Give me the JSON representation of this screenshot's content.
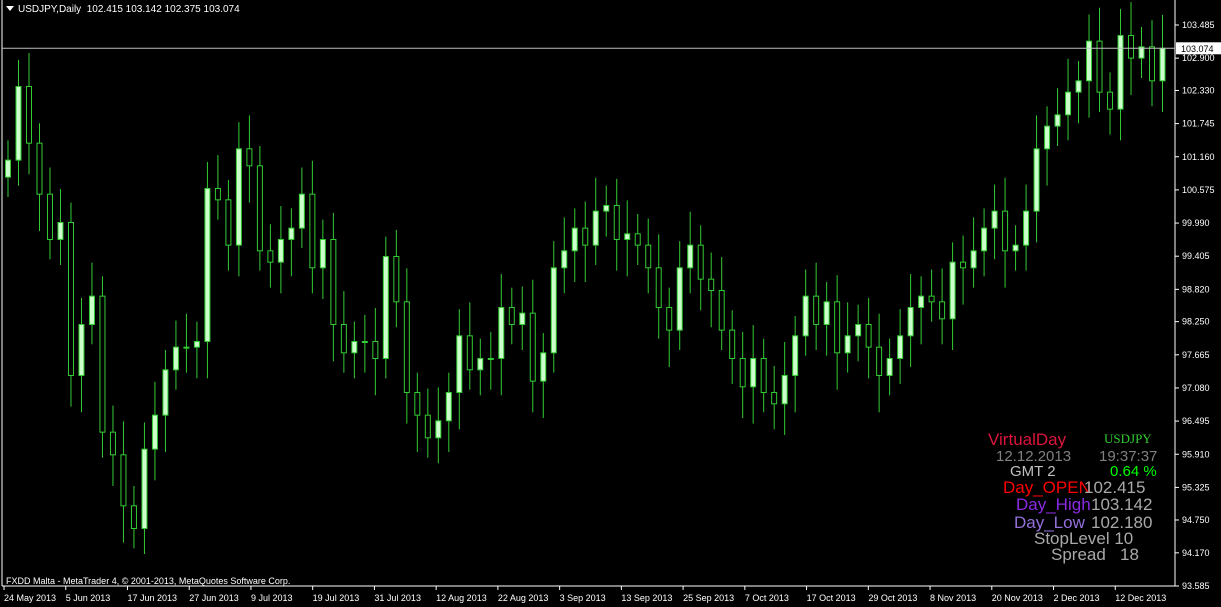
{
  "header": {
    "symbol_timeframe": "USDJPY,Daily",
    "ohlc": "102.415 103.142 102.375 103.074"
  },
  "copyright": "FXDD Malta - MetaTrader 4, © 2001-2013, MetaQuotes Software Corp.",
  "colors": {
    "background": "#000000",
    "bull_candle": "#ccffcc",
    "bear_candle": "#000000",
    "wick": "#33cc33",
    "axis": "#ffffff",
    "price_line": "#c0c0c0"
  },
  "indicator": {
    "title": "VirtualDay",
    "symbol": "USDJPY",
    "date": "12.12.2013",
    "time": "19:37:37",
    "gmt": "GMT 2",
    "change": "0.64 %",
    "day_open_label": "Day_OPEN",
    "day_open_value": "102.415",
    "day_high_label": "Day_High",
    "day_high_value": "103.142",
    "day_low_label": "Day_Low",
    "day_low_value": "102.180",
    "stoplevel": "StopLevel 10",
    "spread": "Spread   18",
    "colors": {
      "title": "#dc143c",
      "symbol": "#32cd32",
      "date": "#808080",
      "time": "#808080",
      "gmt": "#c0c0c0",
      "change": "#00ff00",
      "open_label": "#ff0000",
      "high_label": "#8a2be2",
      "low_label": "#9370db",
      "values": "#a9a9a9",
      "stoplevel": "#a9a9a9",
      "spread": "#a9a9a9"
    }
  },
  "chart_data": {
    "type": "candlestick",
    "ylim": [
      93.585,
      103.485
    ],
    "current_price": "103.074",
    "y_ticks": [
      "103.485",
      "102.900",
      "102.330",
      "101.745",
      "101.160",
      "100.575",
      "99.990",
      "99.405",
      "98.820",
      "98.250",
      "97.665",
      "97.080",
      "96.495",
      "95.910",
      "95.325",
      "94.750",
      "94.170",
      "93.585"
    ],
    "x_ticks": [
      "24 May 2013",
      "5 Jun 2013",
      "17 Jun 2013",
      "27 Jun 2013",
      "9 Jul 2013",
      "19 Jul 2013",
      "31 Jul 2013",
      "12 Aug 2013",
      "22 Aug 2013",
      "3 Sep 2013",
      "13 Sep 2013",
      "25 Sep 2013",
      "7 Oct 2013",
      "17 Oct 2013",
      "29 Oct 2013",
      "8 Nov 2013",
      "20 Nov 2013",
      "2 Dec 2013",
      "12 Dec 2013"
    ],
    "closes": [
      101.1,
      102.4,
      101.4,
      100.5,
      99.7,
      100.0,
      97.3,
      98.2,
      98.7,
      96.3,
      95.9,
      95.0,
      94.6,
      96.0,
      96.6,
      97.4,
      97.8,
      97.8,
      97.9,
      100.6,
      100.4,
      99.6,
      101.3,
      101.0,
      99.5,
      99.3,
      99.7,
      99.9,
      100.5,
      99.2,
      99.7,
      98.2,
      97.7,
      97.9,
      97.9,
      97.6,
      99.4,
      98.6,
      97.0,
      96.6,
      96.2,
      96.5,
      97.0,
      98.0,
      97.4,
      97.6,
      97.6,
      98.5,
      98.2,
      98.4,
      97.2,
      97.7,
      99.2,
      99.5,
      99.9,
      99.6,
      100.2,
      100.3,
      99.7,
      99.8,
      99.6,
      99.2,
      98.5,
      98.1,
      99.2,
      99.6,
      99.0,
      98.8,
      98.1,
      97.6,
      97.1,
      97.6,
      97.0,
      96.8,
      97.3,
      98.0,
      98.7,
      98.2,
      98.6,
      97.7,
      98.0,
      98.2,
      97.8,
      97.3,
      97.6,
      98.0,
      98.5,
      98.7,
      98.6,
      98.3,
      99.3,
      99.2,
      99.5,
      99.9,
      100.2,
      99.5,
      99.6,
      100.2,
      101.3,
      101.7,
      101.9,
      102.3,
      102.5,
      103.2,
      102.3,
      102.0,
      103.3,
      102.9,
      103.1,
      102.5,
      103.074
    ]
  }
}
